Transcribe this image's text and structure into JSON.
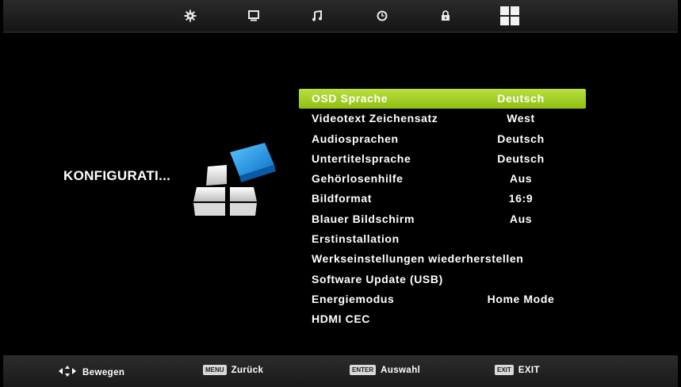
{
  "topbar": {
    "tabs": [
      {
        "icon": "gear-icon",
        "name": "tab-setup"
      },
      {
        "icon": "monitor-icon",
        "name": "tab-picture"
      },
      {
        "icon": "music-note-icon",
        "name": "tab-sound"
      },
      {
        "icon": "clock-icon",
        "name": "tab-time"
      },
      {
        "icon": "lock-icon",
        "name": "tab-lock"
      },
      {
        "icon": "grid-icon",
        "name": "tab-configuration"
      }
    ],
    "active_tab": 5
  },
  "section_title": "KONFIGURATI...",
  "menu": {
    "selected_index": 0,
    "items": [
      {
        "label": "OSD Sprache",
        "value": "Deutsch"
      },
      {
        "label": "Videotext Zeichensatz",
        "value": "West"
      },
      {
        "label": "Audiosprachen",
        "value": "Deutsch"
      },
      {
        "label": "Untertitelsprache",
        "value": "Deutsch"
      },
      {
        "label": "Gehörlosenhilfe",
        "value": "Aus"
      },
      {
        "label": "Bildformat",
        "value": "16:9"
      },
      {
        "label": "Blauer Bildschirm",
        "value": "Aus"
      },
      {
        "label": "Erstinstallation",
        "value": ""
      },
      {
        "label": "Werkseinstellungen wiederherstellen",
        "value": ""
      },
      {
        "label": "Software Update (USB)",
        "value": ""
      },
      {
        "label": "Energiemodus",
        "value": "Home Mode"
      },
      {
        "label": "HDMI CEC",
        "value": ""
      }
    ]
  },
  "footer": {
    "move": {
      "label": "Bewegen"
    },
    "back": {
      "key": "MENU",
      "label": "Zurück"
    },
    "select": {
      "key": "ENTER",
      "label": "Auswahl"
    },
    "exit": {
      "key": "EXIT",
      "label": "EXIT"
    }
  },
  "colors": {
    "selection": "#9fcc1c",
    "accent_blue": "#1e8fe0"
  }
}
